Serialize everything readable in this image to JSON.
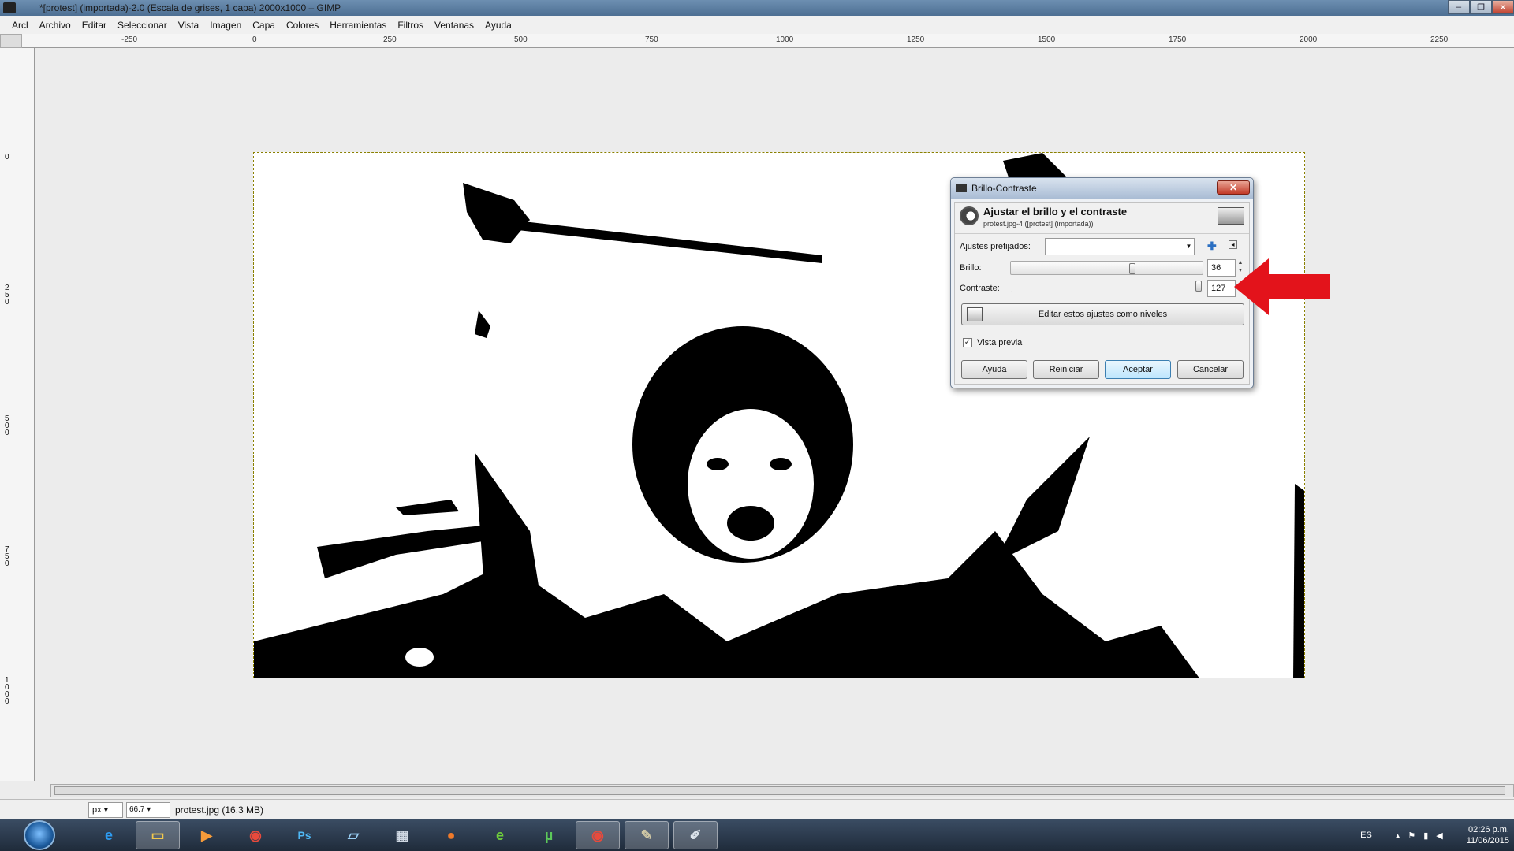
{
  "window": {
    "title": "*[protest] (importada)-2.0 (Escala de grises, 1 capa) 2000x1000 – GIMP"
  },
  "menu": [
    "Arcl",
    "Archivo",
    "Editar",
    "Seleccionar",
    "Vista",
    "Imagen",
    "Capa",
    "Colores",
    "Herramientas",
    "Filtros",
    "Ventanas",
    "Ayuda"
  ],
  "ruler": {
    "h_labels": [
      "-250",
      "0",
      "250",
      "500",
      "750",
      "1000",
      "1250",
      "1500",
      "1750",
      "2000",
      "2250"
    ],
    "v_labels": [
      "0",
      "2\n5\n0",
      "5\n0\n0",
      "7\n5\n0",
      "1\n0\n0\n0"
    ]
  },
  "dialog": {
    "title": "Brillo-Contraste",
    "heading": "Ajustar el brillo y el contraste",
    "subheading": "protest.jpg-4 ([protest] (importada))",
    "presets_label": "Ajustes prefijados:",
    "presets_value": "",
    "brightness_label": "Brillo:",
    "brightness_value": "36",
    "brightness": 36,
    "contrast_label": "Contraste:",
    "contrast_value": "127",
    "contrast": 127,
    "levels_button": "Editar estos ajustes como niveles",
    "preview_label": "Vista previa",
    "preview_checked": true,
    "buttons": {
      "help": "Ayuda",
      "reset": "Reiniciar",
      "ok": "Aceptar",
      "cancel": "Cancelar"
    }
  },
  "status": {
    "unit": "px",
    "zoom": "66.7",
    "file": "protest.jpg (16.3 MB)"
  },
  "tray": {
    "lang": "ES",
    "time": "02:26 p.m.",
    "date": "11/06/2015"
  },
  "colors": {
    "arrow": "#e3131b",
    "selection": "#8a8000"
  }
}
